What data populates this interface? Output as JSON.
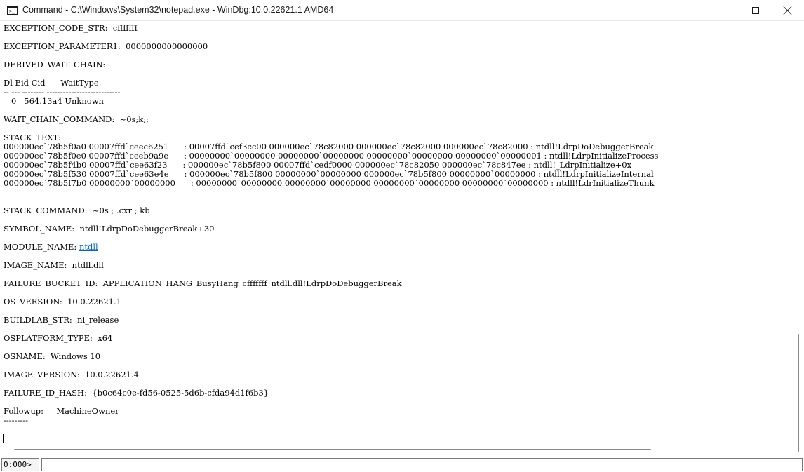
{
  "window": {
    "title": "Command - C:\\Windows\\System32\\notepad.exe - WinDbg:10.0.22621.1 AMD64",
    "icon": "console-icon",
    "icon_glyph": ">_"
  },
  "output_lines": [
    "EXCEPTION_CODE_STR:  cfffffff",
    "EXCEPTION_PARAMETER1:  0000000000000000",
    "DERIVED_WAIT_CHAIN:",
    "Dl Eid Cid      WaitType",
    "-- --- -------- ---------------------------",
    "   0   564.13a4 Unknown",
    "WAIT_CHAIN_COMMAND:  ~0s;k;;",
    "STACK_TEXT:",
    "000000ec`78b5f0a0 00007ffd`ceec6251      : 00007ffd`cef3cc00 000000ec`78c82000 000000ec`78c82000 000000ec`78c82000 : ntdll!LdrpDoDebuggerBreak",
    "000000ec`78b5f0e0 00007ffd`ceeb9a9e      : 00000000`00000000 00000000`00000000 00000000`00000000 00000000`00000001 : ntdll!LdrpInitializeProcess",
    "000000ec`78b5f4b0 00007ffd`cee63f23      : 000000ec`78b5f800 00007ffd`cedf0000 000000ec`78c82050 000000ec`78c847ee : ntdll!_LdrpInitialize+0x",
    "000000ec`78b5f530 00007ffd`cee63e4e      : 000000ec`78b5f800 00000000`00000000 000000ec`78b5f800 00000000`00000000 : ntdll!LdrpInitializeInternal",
    "000000ec`78b5f7b0 00000000`00000000      : 00000000`00000000 00000000`00000000 00000000`00000000 00000000`00000000 : ntdll!LdrInitializeThunk",
    "STACK_COMMAND:  ~0s ; .cxr ; kb",
    "SYMBOL_NAME:  ntdll!LdrpDoDebuggerBreak+30",
    "MODULE_NAME: ",
    "IMAGE_NAME:  ntdll.dll",
    "FAILURE_BUCKET_ID:  APPLICATION_HANG_BusyHang_cfffffff_ntdll.dll!LdrpDoDebuggerBreak",
    "OS_VERSION:  10.0.22621.1",
    "BUILDLAB_STR:  ni_release",
    "OSPLATFORM_TYPE:  x64",
    "OSNAME:  Windows 10",
    "IMAGE_VERSION:  10.0.22621.4",
    "FAILURE_ID_HASH:  {b0c64c0e-fd56-0525-5d6b-cfda94d1f6b3}",
    "Followup:     MachineOwner",
    "---------"
  ],
  "module_link": "ntdll",
  "command_bar": {
    "prompt": "0:000>",
    "input_value": ""
  }
}
